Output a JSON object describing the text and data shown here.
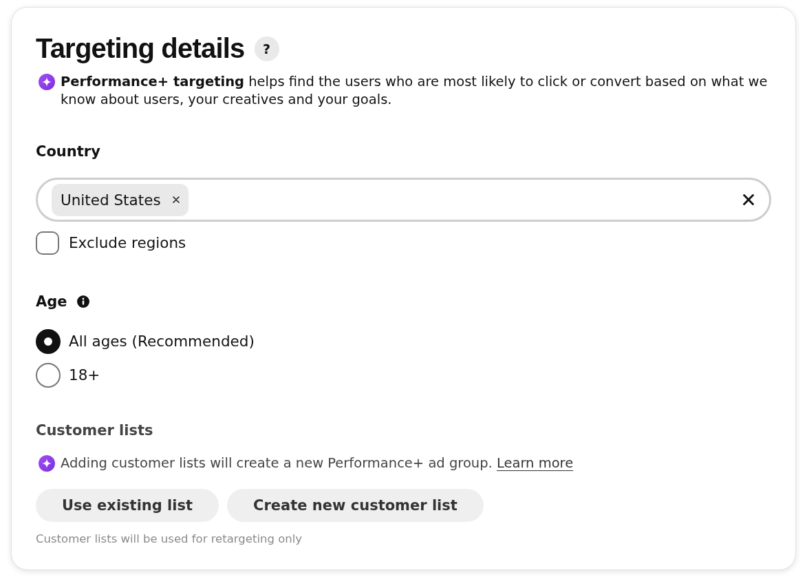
{
  "panel": {
    "title": "Targeting details",
    "help": "?",
    "intro": "**Performance+ targeting** helps find the users who are most likely to click or convert based on what we know about users, your creatives and your goals."
  },
  "country": {
    "label": "Country",
    "chips": [
      {
        "label": "United States"
      }
    ],
    "exclude": {
      "label": "Exclude regions",
      "checked": false
    }
  },
  "age": {
    "label": "Age",
    "options": [
      {
        "label": "All ages (Recommended)",
        "selected": true
      },
      {
        "label": "18+",
        "selected": false
      }
    ]
  },
  "customer_lists": {
    "label": "Customer lists",
    "notice": "Adding customer lists will create a new Performance+ ad group.",
    "link": "Learn more",
    "buttons": [
      "Use existing list",
      "Create new customer list"
    ],
    "helper": "Customer lists will be used for retargeting only"
  }
}
